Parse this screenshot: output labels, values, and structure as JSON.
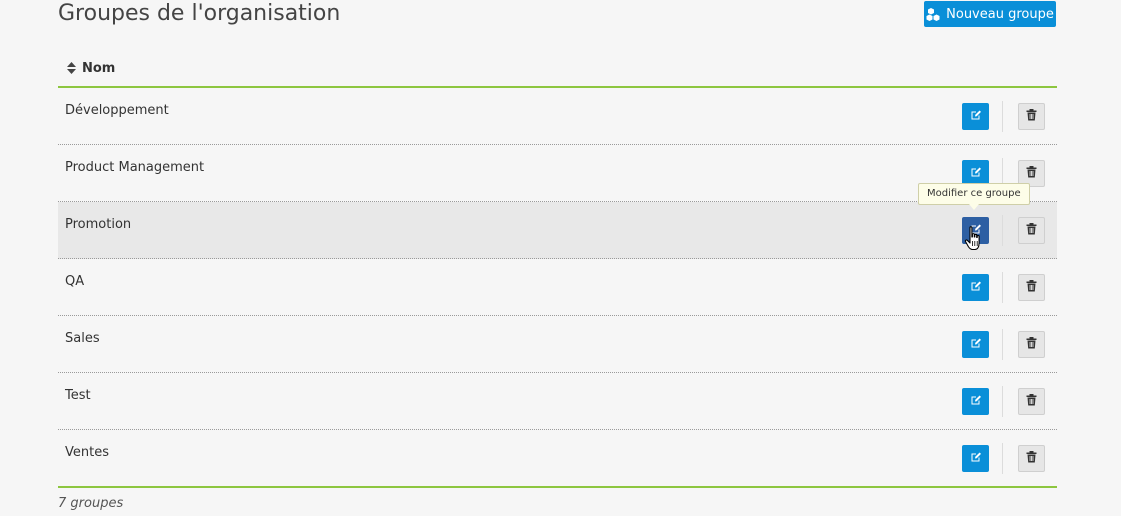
{
  "page": {
    "title": "Groupes de l'organisation",
    "new_group_button": {
      "label": "Nouveau groupe",
      "icon": "cubes-icon",
      "color": "#0a8fd8"
    }
  },
  "table": {
    "column_header": "Nom",
    "sort_icon": "sort-icon",
    "accent_color": "#8dc63f",
    "rows": [
      {
        "name": "Développement"
      },
      {
        "name": "Product Management"
      },
      {
        "name": "Promotion"
      },
      {
        "name": "QA"
      },
      {
        "name": "Sales"
      },
      {
        "name": "Test"
      },
      {
        "name": "Ventes"
      }
    ],
    "hovered_row": "Promotion",
    "edit_icon": "edit-icon",
    "delete_icon": "trash-icon"
  },
  "tooltip": {
    "text": "Modifier ce groupe"
  },
  "footer": {
    "count_text": "7 groupes"
  }
}
